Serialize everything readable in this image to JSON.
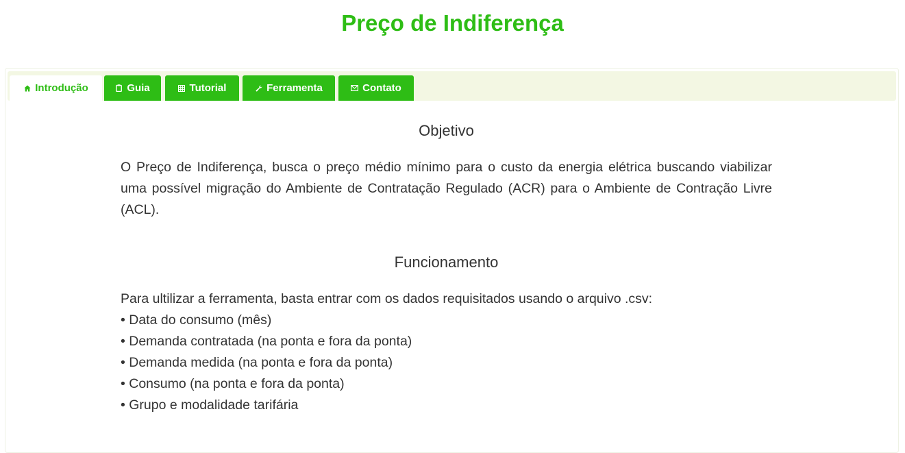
{
  "page": {
    "title": "Preço de Indiferença"
  },
  "colors": {
    "accent": "#2ebd15",
    "tab_strip_bg": "#f3f7e3",
    "text": "#333333"
  },
  "tabs": [
    {
      "label": "Introdução",
      "icon": "home-icon",
      "active": true
    },
    {
      "label": "Guia",
      "icon": "clipboard-icon",
      "active": false
    },
    {
      "label": "Tutorial",
      "icon": "grid-icon",
      "active": false
    },
    {
      "label": "Ferramenta",
      "icon": "wrench-icon",
      "active": false
    },
    {
      "label": "Contato",
      "icon": "envelope-icon",
      "active": false
    }
  ],
  "objetivo": {
    "heading": "Objetivo",
    "text": "O Preço de Indiferença, busca o preço médio mínimo para o custo da energia elétrica buscando viabilizar uma possível migração do Ambiente de Contratação Regulado (ACR) para o Ambiente de Contração Livre (ACL)."
  },
  "funcionamento": {
    "heading": "Funcionamento",
    "intro": "Para ultilizar a ferramenta, basta entrar com os dados requisitados usando o arquivo .csv:",
    "items": [
      "• Data do consumo (mês)",
      "• Demanda contratada (na ponta e fora da ponta)",
      "• Demanda medida (na ponta e fora da ponta)",
      "• Consumo (na ponta e fora da ponta)",
      "• Grupo e modalidade tarifária"
    ]
  }
}
